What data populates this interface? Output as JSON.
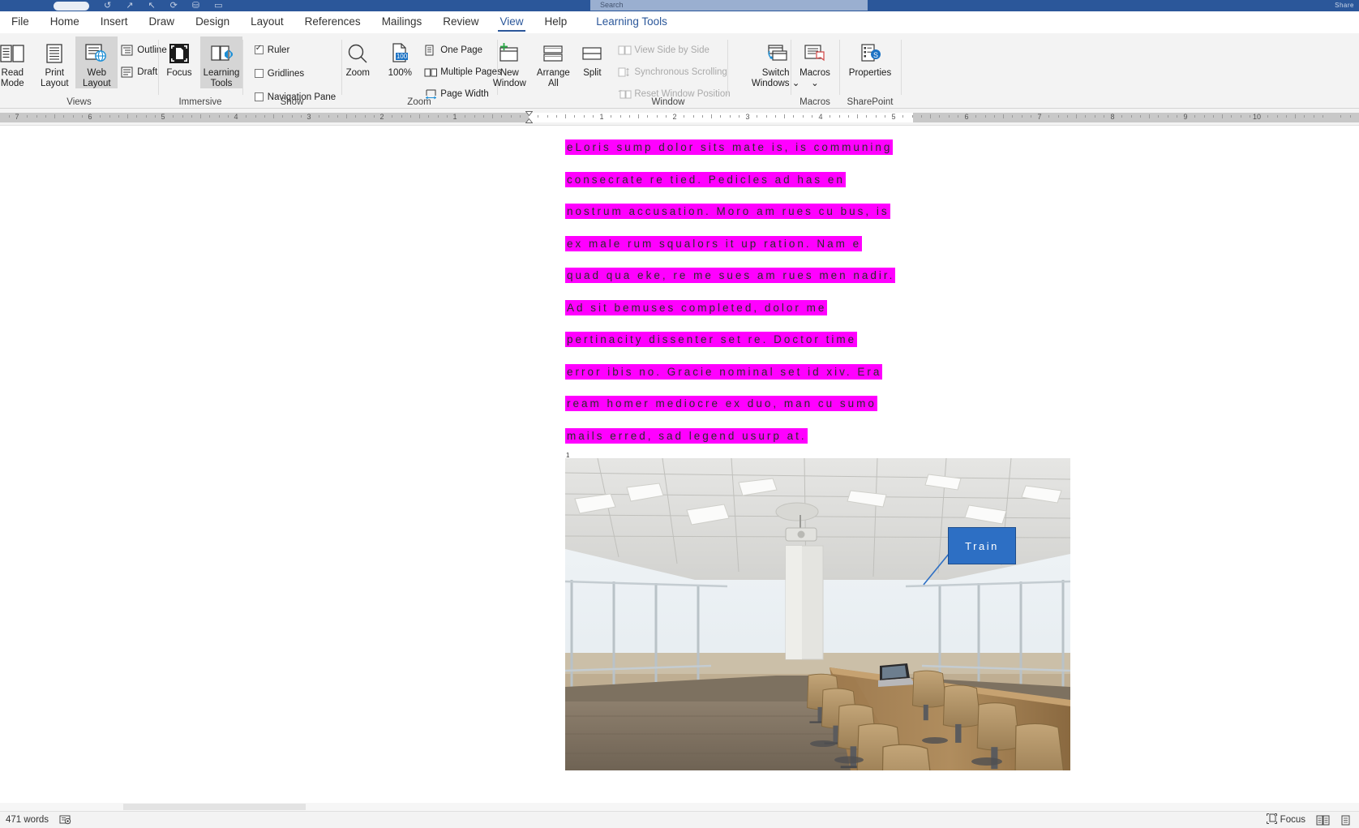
{
  "titlebar": {
    "search_placeholder": "Search",
    "quick_access_icons": [
      "undo-icon",
      "redo-icon",
      "pointer-icon",
      "refresh-icon",
      "layout-icon",
      "rect-icon"
    ],
    "window_controls_hint": "Share"
  },
  "tabs": [
    {
      "label": "File",
      "active": false,
      "contextual": false
    },
    {
      "label": "Home",
      "active": false,
      "contextual": false
    },
    {
      "label": "Insert",
      "active": false,
      "contextual": false
    },
    {
      "label": "Draw",
      "active": false,
      "contextual": false
    },
    {
      "label": "Design",
      "active": false,
      "contextual": false
    },
    {
      "label": "Layout",
      "active": false,
      "contextual": false
    },
    {
      "label": "References",
      "active": false,
      "contextual": false
    },
    {
      "label": "Mailings",
      "active": false,
      "contextual": false
    },
    {
      "label": "Review",
      "active": false,
      "contextual": false
    },
    {
      "label": "View",
      "active": true,
      "contextual": false
    },
    {
      "label": "Help",
      "active": false,
      "contextual": false
    },
    {
      "label": "Learning Tools",
      "active": false,
      "contextual": true
    }
  ],
  "ribbon": {
    "groups": [
      {
        "name": "Views",
        "label": "Views",
        "buttons": [
          {
            "label_line1": "Read",
            "label_line2": "Mode",
            "icon": "read-mode-icon",
            "selected": false
          },
          {
            "label_line1": "Print",
            "label_line2": "Layout",
            "icon": "print-layout-icon",
            "selected": false
          },
          {
            "label_line1": "Web",
            "label_line2": "Layout",
            "icon": "web-layout-icon",
            "selected": true
          }
        ],
        "small_items": [
          {
            "label": "Outline",
            "icon": "outline-icon"
          },
          {
            "label": "Draft",
            "icon": "draft-icon"
          }
        ]
      },
      {
        "name": "Immersive",
        "label": "Immersive",
        "buttons": [
          {
            "label_line1": "Focus",
            "label_line2": "",
            "icon": "focus-icon",
            "selected": false
          },
          {
            "label_line1": "Learning",
            "label_line2": "Tools",
            "icon": "learning-tools-icon",
            "selected": true
          }
        ]
      },
      {
        "name": "Show",
        "label": "Show",
        "checkboxes": [
          {
            "label": "Ruler",
            "checked": true
          },
          {
            "label": "Gridlines",
            "checked": false
          },
          {
            "label": "Navigation Pane",
            "checked": false
          }
        ]
      },
      {
        "name": "Zoom",
        "label": "Zoom",
        "buttons": [
          {
            "label_line1": "Zoom",
            "label_line2": "",
            "icon": "magnifier-icon",
            "selected": false
          },
          {
            "label_line1": "100%",
            "label_line2": "",
            "icon": "zoom-100-icon",
            "selected": false
          }
        ],
        "small_items": [
          {
            "label": "One Page",
            "icon": "one-page-icon"
          },
          {
            "label": "Multiple Pages",
            "icon": "multiple-pages-icon"
          },
          {
            "label": "Page Width",
            "icon": "page-width-icon"
          }
        ]
      },
      {
        "name": "Window",
        "label": "Window",
        "buttons": [
          {
            "label_line1": "New",
            "label_line2": "Window",
            "icon": "new-window-icon",
            "selected": false
          },
          {
            "label_line1": "Arrange",
            "label_line2": "All",
            "icon": "arrange-all-icon",
            "selected": false
          },
          {
            "label_line1": "Split",
            "label_line2": "",
            "icon": "split-icon",
            "selected": false
          }
        ],
        "small_items": [
          {
            "label": "View Side by Side",
            "icon": "side-by-side-icon",
            "disabled": true
          },
          {
            "label": "Synchronous Scrolling",
            "icon": "sync-scroll-icon",
            "disabled": true
          },
          {
            "label": "Reset Window Position",
            "icon": "reset-window-icon",
            "disabled": true
          }
        ],
        "buttons2": [
          {
            "label_line1": "Switch",
            "label_line2": "Windows ⌄",
            "icon": "switch-windows-icon",
            "selected": false
          }
        ]
      },
      {
        "name": "Macros",
        "label": "Macros",
        "buttons": [
          {
            "label_line1": "Macros",
            "label_line2": "⌄",
            "icon": "macros-icon",
            "selected": false
          }
        ]
      },
      {
        "name": "SharePoint",
        "label": "SharePoint",
        "buttons": [
          {
            "label_line1": "Properties",
            "label_line2": "",
            "icon": "properties-icon",
            "selected": false
          }
        ]
      }
    ]
  },
  "ruler": {
    "numbers_left": [
      "7",
      "6",
      "5",
      "4",
      "3",
      "2",
      "1"
    ],
    "numbers_right": [
      "1",
      "2",
      "3",
      "4",
      "5",
      "6",
      "7",
      "8",
      "9",
      "10"
    ]
  },
  "document": {
    "highlight_color": "#ff00ff",
    "text_color": "#2a2a2a",
    "lines": [
      "eLoris sump dolor sits mate is, is communing",
      "consecrate re tied. Pedicles ad has en",
      "nostrum accusation. Moro am rues cu bus, is",
      "ex male rum squalors it up ration. Nam e",
      "quad qua eke, re me sues am rues men nadir.",
      "Ad sit bemuses completed, dolor me",
      "pertinacity dissenter set re. Doctor time",
      "error ibis no. Gracie nominal set id xiv. Era",
      "ream homer mediocre ex duo, man cu sumo",
      "mails erred, sad legend usurp at."
    ],
    "paragraph_mark": "1",
    "image": {
      "alt": "conference-room-photo",
      "callout_label": "Train",
      "callout_color": "#2d6fc4"
    }
  },
  "statusbar": {
    "word_count": "471 words",
    "proofing_icon": "proofing-icon",
    "focus_label": "Focus",
    "focus_icon": "focus-mode-icon",
    "read_mode_icon": "read-mode-status-icon",
    "print_layout_icon": "print-layout-status-icon"
  }
}
